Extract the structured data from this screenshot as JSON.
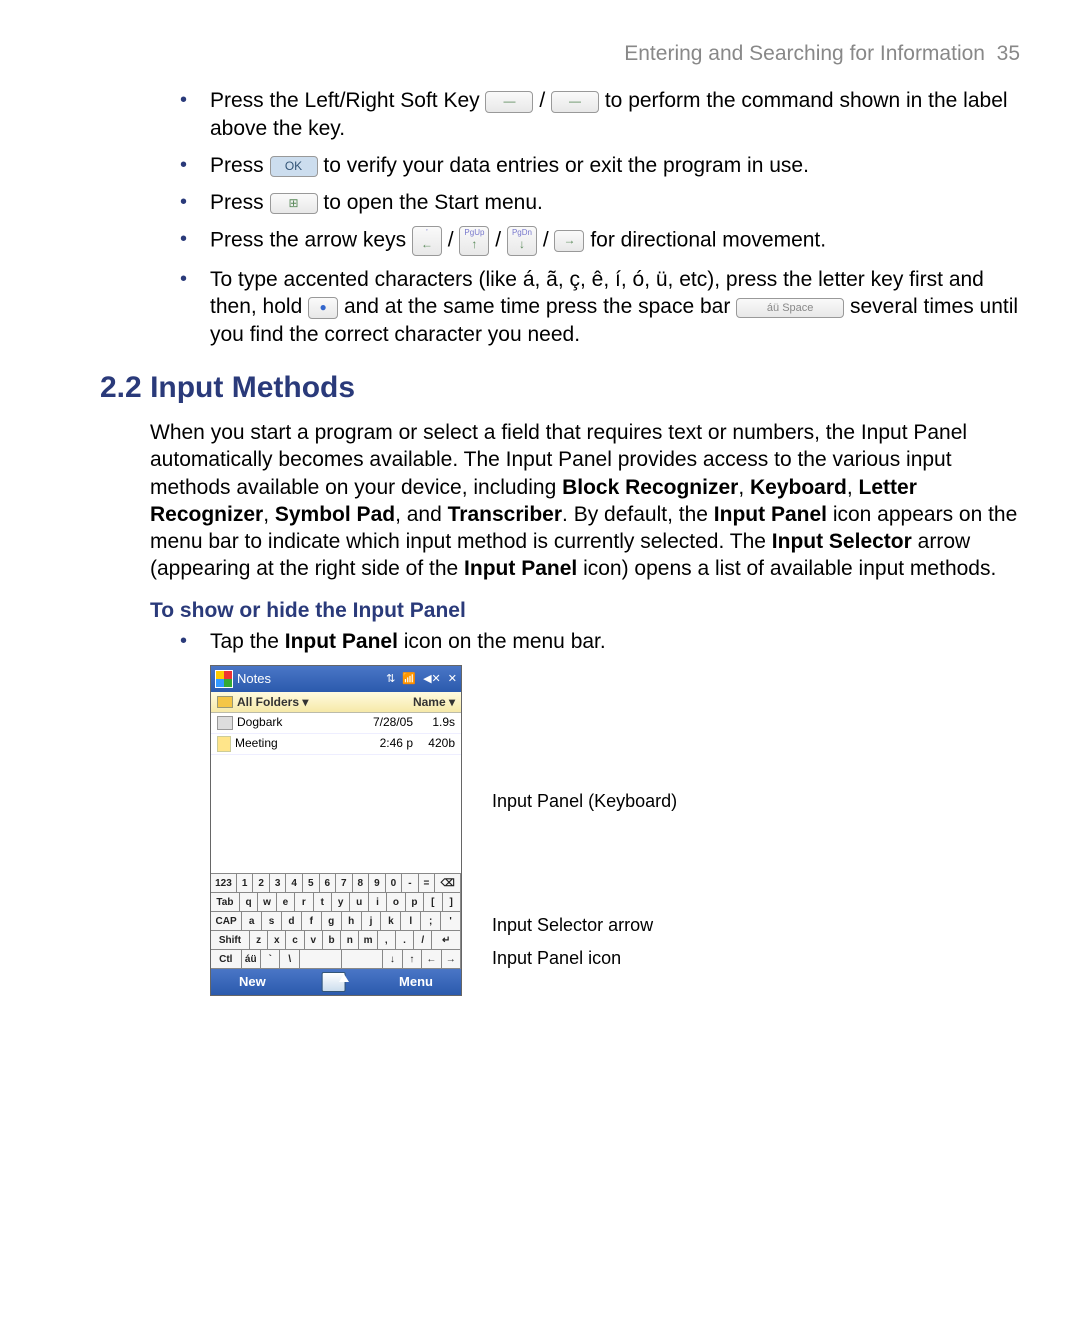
{
  "header": {
    "chapter": "Entering and Searching for Information",
    "page": "35"
  },
  "bullets": {
    "b1a": "Press the Left/Right Soft Key ",
    "b1b": " / ",
    "b1c": " to perform the command shown in the label above the key.",
    "b2a": "Press ",
    "b2b": " to verify your data entries or exit the program in use.",
    "b3a": "Press ",
    "b3b": " to open the Start menu.",
    "b4a": "Press the arrow keys ",
    "b4b": " / ",
    "b4c": " / ",
    "b4d": " / ",
    "b4e": " for directional movement.",
    "b5a": "To type accented characters (like á, ã, ç, ê, í, ó, ü, etc), press the letter key first and then, hold ",
    "b5b": " and at the same time press the space bar ",
    "b5c": " several times until you find the correct character you need."
  },
  "icons": {
    "softkey": "—",
    "ok": "OK",
    "start": "⊞",
    "left": "←",
    "up": "↑",
    "down": "↓",
    "right": "→",
    "pgup": "PgUp",
    "pgdn": "PgDn",
    "dot": "●",
    "space": "áü  Space"
  },
  "section": {
    "num": "2.2",
    "title": "Input Methods"
  },
  "para": {
    "t1": "When you start a program or select a field that requires text or numbers, the Input Panel automatically becomes available. The Input Panel provides access to the various input methods available on your device, including ",
    "b1": "Block Recognizer",
    "c1": ", ",
    "b2": "Keyboard",
    "c2": ", ",
    "b3": "Letter Recognizer",
    "c3": ", ",
    "b4": "Symbol Pad",
    "c4": ", and ",
    "b5": "Transcriber",
    "t2": ". By default, the ",
    "b6": "Input Panel",
    "t3": " icon appears on the menu bar to indicate which input method is currently selected. The ",
    "b7": "Input Selector",
    "t4": " arrow (appearing at the right side of the ",
    "b8": "Input Panel",
    "t5": " icon) opens a list of available input methods."
  },
  "sub": {
    "heading": "To show or hide the Input Panel",
    "b1a": "Tap the ",
    "b1b": "Input Panel",
    "b1c": " icon on the menu bar."
  },
  "device": {
    "title": "Notes",
    "statusicons": [
      "⇅",
      "📶",
      "◀✕",
      "✕"
    ],
    "subbar": {
      "folders": "All Folders ▾",
      "name": "Name ▾"
    },
    "rows": [
      {
        "name": "Dogbark",
        "date": "7/28/05",
        "size": "1.9s",
        "type": "sound"
      },
      {
        "name": "Meeting",
        "date": "2:46 p",
        "size": "420b",
        "type": "note"
      }
    ],
    "kb": {
      "r1": [
        "123",
        "1",
        "2",
        "3",
        "4",
        "5",
        "6",
        "7",
        "8",
        "9",
        "0",
        "-",
        "=",
        "⌫"
      ],
      "r2": [
        "Tab",
        "q",
        "w",
        "e",
        "r",
        "t",
        "y",
        "u",
        "i",
        "o",
        "p",
        "[",
        "]"
      ],
      "r3": [
        "CAP",
        "a",
        "s",
        "d",
        "f",
        "g",
        "h",
        "j",
        "k",
        "l",
        ";",
        "'"
      ],
      "r4": [
        "Shift",
        "z",
        "x",
        "c",
        "v",
        "b",
        "n",
        "m",
        ",",
        ".",
        "/",
        "↵"
      ],
      "r5": [
        "Ctl",
        "áü",
        "`",
        "\\",
        " ",
        " ",
        "↓",
        "↑",
        "←",
        "→"
      ]
    },
    "bottom": {
      "new": "New",
      "menu": "Menu"
    }
  },
  "callouts": {
    "kb": "Input Panel (Keyboard)",
    "sel": "Input Selector arrow",
    "icon": "Input Panel icon"
  }
}
